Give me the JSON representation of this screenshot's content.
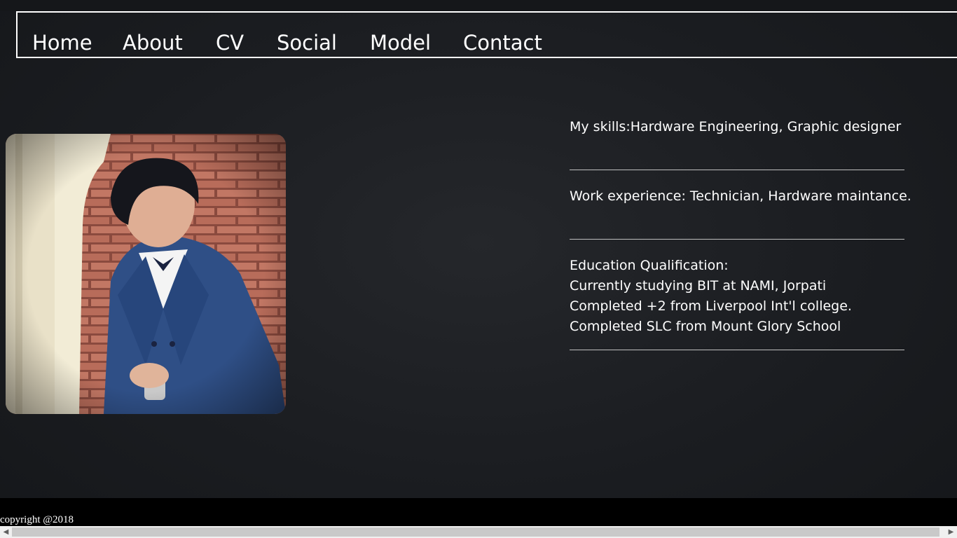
{
  "nav": {
    "items": [
      "Home",
      "About",
      "CV",
      "Social",
      "Model",
      "Contact"
    ]
  },
  "profile": {
    "skills": "My skills:Hardware Engineering, Graphic designer",
    "work": "Work experience: Technician, Hardware maintance.",
    "education": {
      "title": "Education Qualification:",
      "lines": [
        "Currently studying BIT at NAMI, Jorpati",
        "Completed +2 from Liverpool Int'l college.",
        "Completed SLC from Mount Glory School"
      ]
    }
  },
  "footer": {
    "copyright": "copyright @2018"
  },
  "scrollbar": {
    "left_arrow": "◀",
    "right_arrow": "▶"
  },
  "colors": {
    "background": "#1b1d21",
    "text": "#ffffff",
    "footer": "#000000",
    "suit": "#2f4f86",
    "brick": "#b46a56"
  }
}
